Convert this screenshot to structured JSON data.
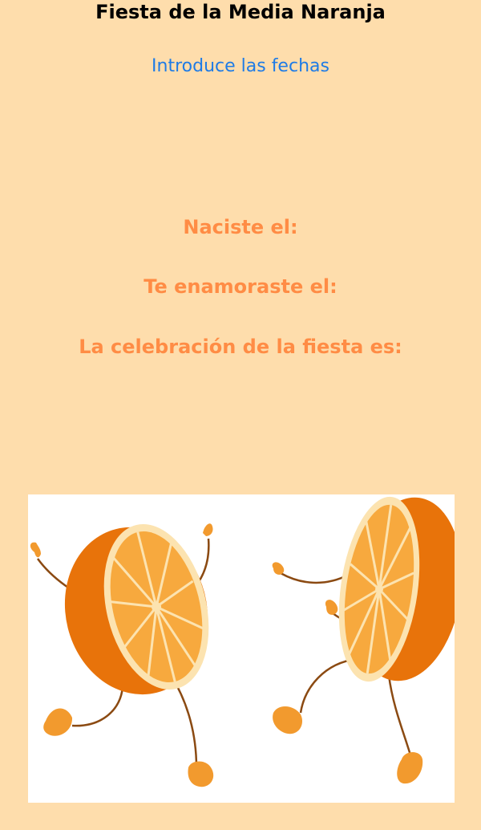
{
  "nav": {
    "title": "Fiesta de la Media Naranja"
  },
  "actions": {
    "enter_dates_label": "Introduce las fechas"
  },
  "labels": {
    "born": "Naciste el:",
    "in_love": "Te enamoraste el:",
    "party": "La celebración de la fiesta es:"
  },
  "colors": {
    "background": "#FEDDAC",
    "link": "#1E7BE6",
    "label": "#FF8C45",
    "orange_peel": "#E8730A",
    "orange_flesh": "#F7A93E",
    "orange_pith": "#FCE3B0"
  },
  "illustration": {
    "icon": "dancing-oranges-illustration"
  }
}
